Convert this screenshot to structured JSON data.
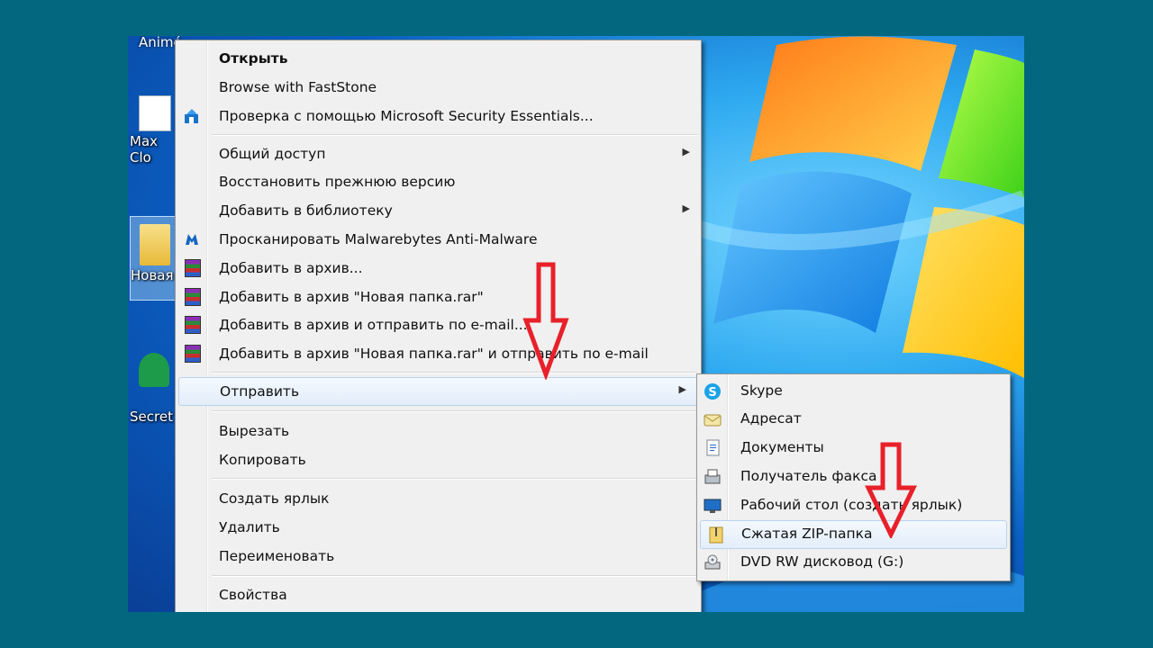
{
  "desktop": {
    "top_label": "Animé",
    "icons": [
      {
        "label": "Max Cloud",
        "line1": "Max",
        "line2": "Clo"
      },
      {
        "label": "Новая папка"
      },
      {
        "label": "Secret"
      }
    ]
  },
  "context_menu": {
    "items": [
      {
        "label": "Открыть"
      },
      {
        "label": "Browse with FastStone"
      },
      {
        "label": "Проверка с помощью Microsoft Security Essentials..."
      },
      {
        "label": "Общий доступ"
      },
      {
        "label": "Восстановить прежнюю версию"
      },
      {
        "label": "Добавить в библиотеку"
      },
      {
        "label": "Просканировать Malwarebytes Anti-Malware"
      },
      {
        "label": "Добавить в архив..."
      },
      {
        "label": "Добавить в архив \"Новая папка.rar\""
      },
      {
        "label": "Добавить в архив и отправить по e-mail..."
      },
      {
        "label": "Добавить в архив \"Новая папка.rar\" и отправить по e-mail"
      },
      {
        "label": "Отправить"
      },
      {
        "label": "Вырезать"
      },
      {
        "label": "Копировать"
      },
      {
        "label": "Создать ярлык"
      },
      {
        "label": "Удалить"
      },
      {
        "label": "Переименовать"
      },
      {
        "label": "Свойства"
      }
    ]
  },
  "sendto_menu": {
    "items": [
      {
        "label": "Skype",
        "icon": "skype-icon"
      },
      {
        "label": "Адресат",
        "icon": "mail-recipient-icon"
      },
      {
        "label": "Документы",
        "icon": "documents-icon"
      },
      {
        "label": "Получатель факса",
        "icon": "fax-icon"
      },
      {
        "label": "Рабочий стол (создать ярлык)",
        "icon": "desktop-icon"
      },
      {
        "label": "Сжатая ZIP-папка",
        "icon": "zip-folder-icon"
      },
      {
        "label": "DVD RW дисковод (G:)",
        "icon": "dvd-drive-icon"
      }
    ]
  },
  "colors": {
    "frame": "#03677f",
    "menu_bg": "#f0f0f0",
    "highlight": "#e3eefa",
    "annotation_arrow": "#e8202a"
  }
}
